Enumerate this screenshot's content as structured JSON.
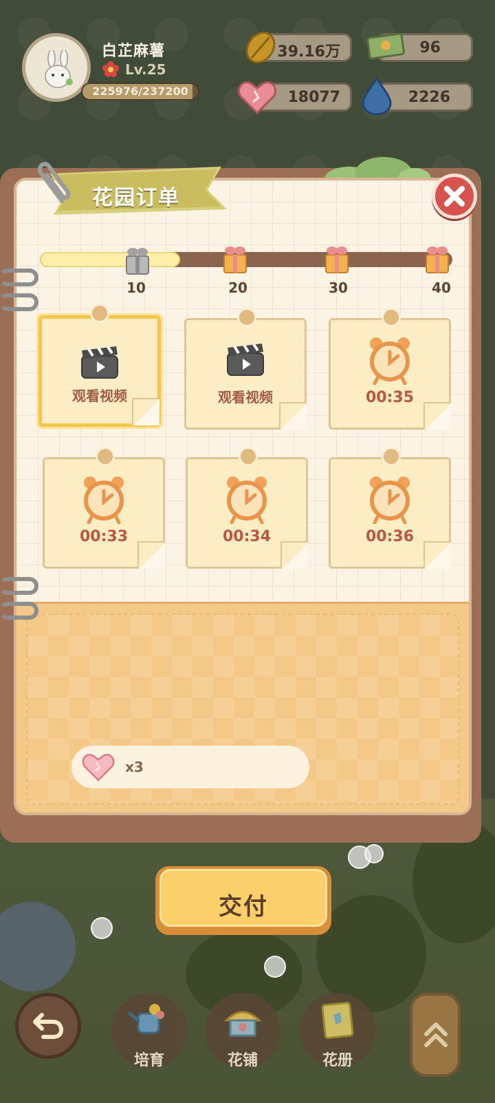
{
  "player": {
    "name": "白芷麻薯",
    "level": "Lv.25",
    "exp_text": "225976/237200",
    "exp_fraction": 0.953
  },
  "resources": [
    {
      "name": "leaf",
      "value": "39.16万",
      "icon": "leaf-icon"
    },
    {
      "name": "ticket",
      "value": "96",
      "icon": "ticket-icon"
    },
    {
      "name": "heart",
      "value": "18077",
      "icon": "heart-gem-icon"
    },
    {
      "name": "water",
      "value": "2226",
      "icon": "water-drop-icon"
    }
  ],
  "panel": {
    "title": "花园订单",
    "progress": {
      "fraction": 0.34,
      "milestones": [
        "10",
        "20",
        "30",
        "40"
      ]
    },
    "orders": [
      {
        "type": "video",
        "label": "观看视频"
      },
      {
        "type": "video",
        "label": "观看视频"
      },
      {
        "type": "timer",
        "label": "00:35"
      },
      {
        "type": "timer",
        "label": "00:33"
      },
      {
        "type": "timer",
        "label": "00:34"
      },
      {
        "type": "timer",
        "label": "00:36"
      }
    ],
    "reward": {
      "icon": "heart-gem-icon",
      "count": "x3"
    }
  },
  "deliver_label": "交付",
  "nav": [
    {
      "label": "培育",
      "icon": "watering-can-icon"
    },
    {
      "label": "花铺",
      "icon": "flower-shop-icon"
    },
    {
      "label": "花册",
      "icon": "flower-album-icon"
    }
  ],
  "colors": {
    "accent": "#fbcf6a",
    "close": "#d8534d",
    "panel_bottom": "#f4c988"
  }
}
